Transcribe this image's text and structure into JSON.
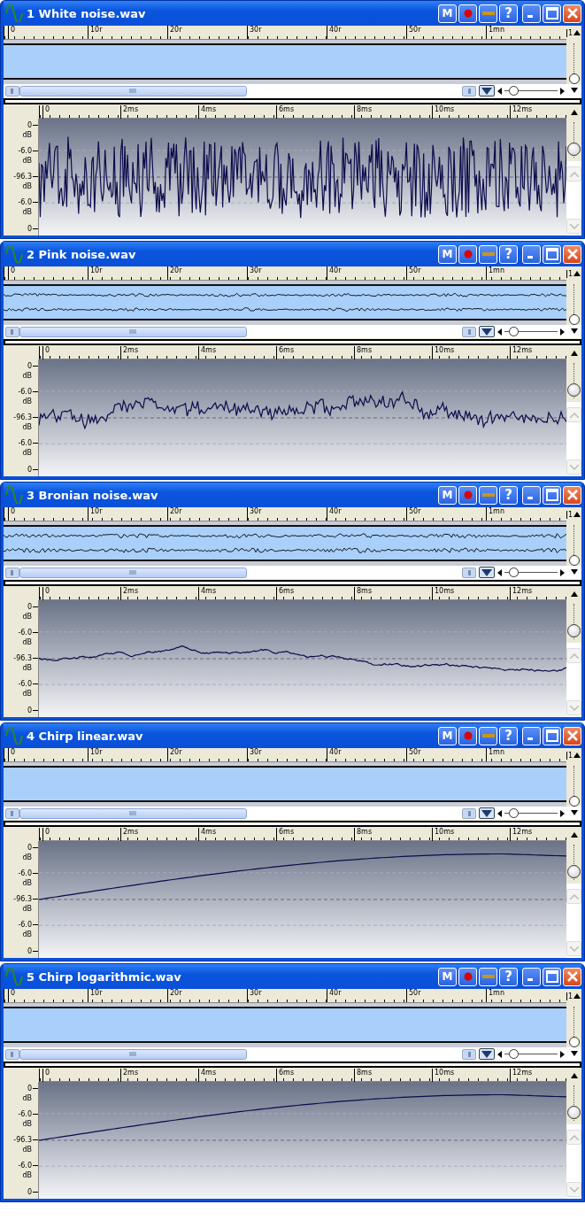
{
  "windows": [
    {
      "title": "1 White noise.wav",
      "kind": "white",
      "buttons": [
        "M",
        "?"
      ],
      "overview_ruler": [
        "0",
        "10r",
        "20r",
        "30r",
        "40r",
        "50r",
        "1mn"
      ],
      "overview_end": "1",
      "detail_ruler": [
        "0",
        "2ms",
        "4ms",
        "6ms",
        "8ms",
        "10ms",
        "12ms"
      ],
      "axis": [
        {
          "value": "0",
          "unit": "dB"
        },
        {
          "value": "-6.0",
          "unit": "dB"
        },
        {
          "value": "-96.3",
          "unit": "dB"
        },
        {
          "value": "-6.0",
          "unit": "dB"
        },
        {
          "value": "0"
        }
      ],
      "zoom": {
        "level": 0.1
      },
      "overview_gain": {
        "level": 0
      },
      "detail_gain": {
        "level": 0.15
      }
    },
    {
      "title": "2 Pink noise.wav",
      "kind": "pink",
      "buttons": [
        "M",
        "?"
      ],
      "overview_ruler": [
        "0",
        "10r",
        "20r",
        "30r",
        "40r",
        "50r",
        "1mn"
      ],
      "overview_end": "1",
      "detail_ruler": [
        "0",
        "2ms",
        "4ms",
        "6ms",
        "8ms",
        "10ms",
        "12ms"
      ],
      "axis": [
        {
          "value": "0",
          "unit": "dB"
        },
        {
          "value": "-6.0",
          "unit": "dB"
        },
        {
          "value": "-96.3",
          "unit": "dB"
        },
        {
          "value": "-6.0",
          "unit": "dB"
        },
        {
          "value": "0"
        }
      ],
      "zoom": {
        "level": 0.1
      },
      "overview_gain": {
        "level": 0
      },
      "detail_gain": {
        "level": 0.15
      }
    },
    {
      "title": "3 Bronian noise.wav",
      "kind": "brown",
      "buttons": [
        "M",
        "?"
      ],
      "overview_ruler": [
        "0",
        "10r",
        "20r",
        "30r",
        "40r",
        "50r",
        "1mn"
      ],
      "overview_end": "1",
      "detail_ruler": [
        "0",
        "2ms",
        "4ms",
        "6ms",
        "8ms",
        "10ms",
        "12ms"
      ],
      "axis": [
        {
          "value": "0",
          "unit": "dB"
        },
        {
          "value": "-6.0",
          "unit": "dB"
        },
        {
          "value": "-96.3",
          "unit": "dB"
        },
        {
          "value": "-6.0",
          "unit": "dB"
        },
        {
          "value": "0"
        }
      ],
      "zoom": {
        "level": 0.1
      },
      "overview_gain": {
        "level": 0
      },
      "detail_gain": {
        "level": 0.15
      }
    },
    {
      "title": "4 Chirp linear.wav",
      "kind": "chirp",
      "buttons": [
        "M",
        "?"
      ],
      "overview_ruler": [
        "0",
        "10r",
        "20r",
        "30r",
        "40r",
        "50r",
        "1mn"
      ],
      "overview_end": "1",
      "detail_ruler": [
        "0",
        "2ms",
        "4ms",
        "6ms",
        "8ms",
        "10ms",
        "12ms"
      ],
      "axis": [
        {
          "value": "0",
          "unit": "dB"
        },
        {
          "value": "-6.0",
          "unit": "dB"
        },
        {
          "value": "-96.3",
          "unit": "dB"
        },
        {
          "value": "-6.0",
          "unit": "dB"
        },
        {
          "value": "0"
        }
      ],
      "zoom": {
        "level": 0.1
      },
      "overview_gain": {
        "level": 0
      },
      "detail_gain": {
        "level": 0.15
      }
    },
    {
      "title": "5 Chirp logarithmic.wav",
      "kind": "chirp",
      "buttons": [
        "M",
        "?"
      ],
      "overview_ruler": [
        "0",
        "10r",
        "20r",
        "30r",
        "40r",
        "50r",
        "1mn"
      ],
      "overview_end": "1",
      "detail_ruler": [
        "0",
        "2ms",
        "4ms",
        "6ms",
        "8ms",
        "10ms",
        "12ms"
      ],
      "axis": [
        {
          "value": "0",
          "unit": "dB"
        },
        {
          "value": "-6.0",
          "unit": "dB"
        },
        {
          "value": "-96.3",
          "unit": "dB"
        },
        {
          "value": "-6.0",
          "unit": "dB"
        },
        {
          "value": "0"
        }
      ],
      "zoom": {
        "level": 0.1
      },
      "overview_gain": {
        "level": 0
      },
      "detail_gain": {
        "level": 0.15
      }
    }
  ]
}
